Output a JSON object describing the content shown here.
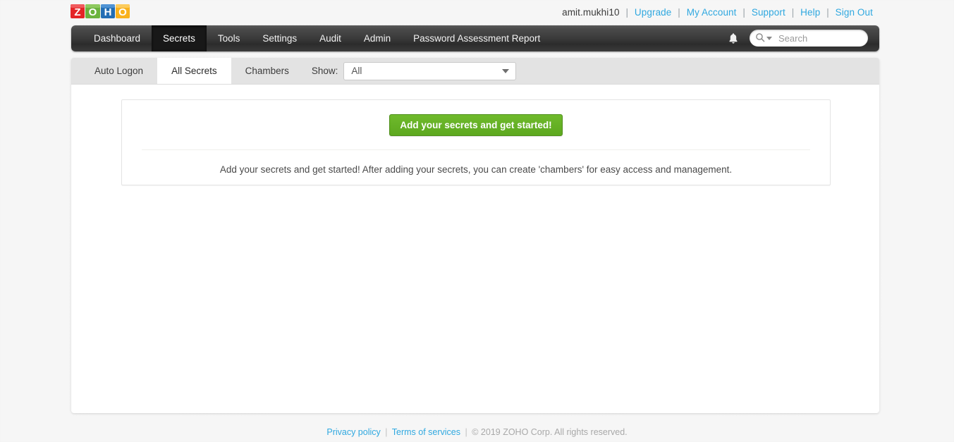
{
  "header": {
    "logo_alt": "ZOHO",
    "username": "amit.mukhi10",
    "links": [
      {
        "label": "Upgrade"
      },
      {
        "label": "My Account"
      },
      {
        "label": "Support"
      },
      {
        "label": "Help"
      },
      {
        "label": "Sign Out"
      }
    ],
    "separator": "|"
  },
  "nav": {
    "items": [
      {
        "label": "Dashboard",
        "active": false
      },
      {
        "label": "Secrets",
        "active": true
      },
      {
        "label": "Tools",
        "active": false
      },
      {
        "label": "Settings",
        "active": false
      },
      {
        "label": "Audit",
        "active": false
      },
      {
        "label": "Admin",
        "active": false
      },
      {
        "label": "Password Assessment Report",
        "active": false
      }
    ],
    "notification_icon": "bell-icon",
    "search": {
      "placeholder": "Search",
      "value": "",
      "icon": "search-icon",
      "caret_icon": "chevron-down-icon"
    }
  },
  "subtabs": {
    "items": [
      {
        "label": "Auto Logon",
        "active": false
      },
      {
        "label": "All Secrets",
        "active": true
      },
      {
        "label": "Chambers",
        "active": false
      }
    ],
    "show_label": "Show:",
    "show_value": "All",
    "show_options": [
      "All"
    ]
  },
  "card": {
    "cta_label": "Add your secrets and get started!",
    "description": "Add your secrets and get started! After adding your secrets, you can create 'chambers' for easy access and management."
  },
  "footer": {
    "privacy": "Privacy policy",
    "terms": "Terms of services",
    "separator": "|",
    "copyright": "© 2019  ZOHO Corp. All rights reserved."
  },
  "colors": {
    "accent_link": "#2fa8e0",
    "cta_green": "#5da81f",
    "nav_dark": "#3a3a3a",
    "nav_active": "#181818",
    "subtab_bar": "#e3e3e3"
  }
}
